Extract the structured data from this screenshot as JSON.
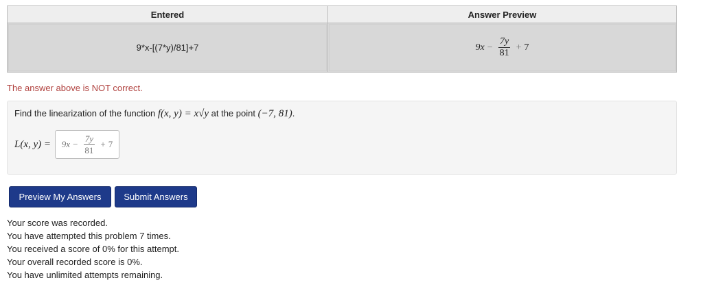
{
  "results_table": {
    "headers": [
      "Entered",
      "Answer Preview"
    ],
    "entered_value": "9*x-[(7*y)/81]+7",
    "preview": {
      "term1": "9x",
      "op1": "−",
      "frac_num": "7y",
      "frac_den": "81",
      "op2": "+",
      "term2": "7"
    }
  },
  "feedback": "The answer above is NOT correct.",
  "problem": {
    "text_before": "Find the linearization of the function ",
    "function_expr": "f(x, y) = x√y",
    "text_middle": " at the point ",
    "point": "(−7, 81)",
    "text_after": ".",
    "answer_label": "L(x, y) =",
    "answer_preview": {
      "term1": "9x",
      "op1": "−",
      "frac_num": "7y",
      "frac_den": "81",
      "op2": "+",
      "term2": "7"
    }
  },
  "buttons": {
    "preview_label": "Preview My Answers",
    "submit_label": "Submit Answers"
  },
  "status_lines": [
    "Your score was recorded.",
    "You have attempted this problem 7 times.",
    "You received a score of 0% for this attempt.",
    "Your overall recorded score is 0%.",
    "You have unlimited attempts remaining."
  ]
}
